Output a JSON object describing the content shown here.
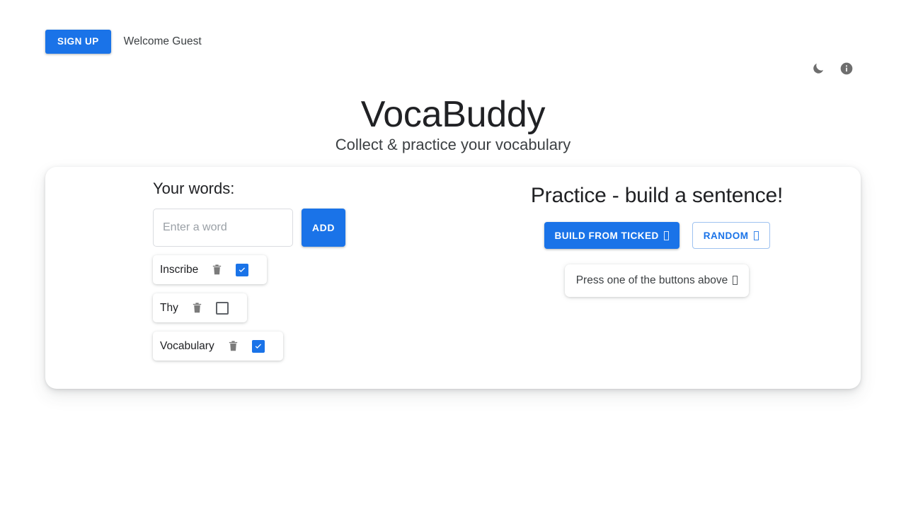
{
  "topbar": {
    "signup_label": "SIGN UP",
    "welcome_text": "Welcome Guest"
  },
  "icons": {
    "dark_mode": "moon-icon",
    "info": "info-icon"
  },
  "header": {
    "title": "VocaBuddy",
    "subtitle": "Collect & practice your vocabulary"
  },
  "words_panel": {
    "heading": "Your words:",
    "input_placeholder": "Enter a word",
    "input_value": "",
    "add_label": "ADD",
    "items": [
      {
        "word": "Inscribe",
        "checked": true,
        "delete_icon": "trash-icon"
      },
      {
        "word": "Thy",
        "checked": false,
        "delete_icon": "trash-icon"
      },
      {
        "word": "Vocabulary",
        "checked": true,
        "delete_icon": "trash-icon"
      }
    ]
  },
  "practice_panel": {
    "heading": "Practice - build a sentence!",
    "build_label": "BUILD FROM TICKED",
    "random_label": "RANDOM",
    "result_text": "Press one of the buttons above"
  },
  "colors": {
    "accent": "#1a73e8",
    "page_background": "#ffffff",
    "card_background": "#ffffff",
    "text": "#202124",
    "muted_text": "#5f6368",
    "icon_gray": "#6e6e6e"
  }
}
